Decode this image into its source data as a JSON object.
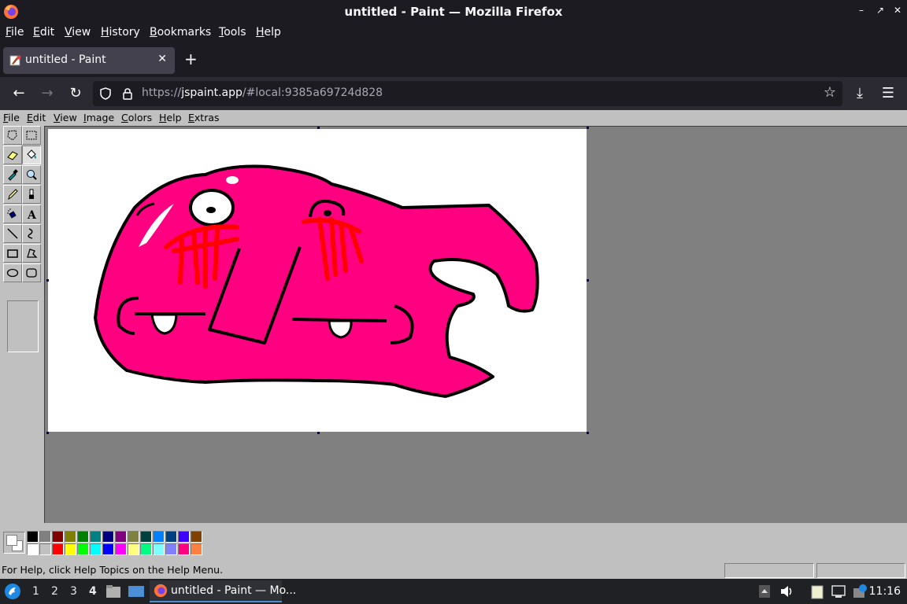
{
  "window": {
    "title": "untitled - Paint — Mozilla Firefox",
    "controls": [
      "–",
      "↗",
      "✕"
    ]
  },
  "firefox_menu": [
    "File",
    "Edit",
    "View",
    "History",
    "Bookmarks",
    "Tools",
    "Help"
  ],
  "tab": {
    "label": "untitled - Paint",
    "close": "✕",
    "new_tab": "+"
  },
  "nav": {
    "back": "←",
    "forward": "→",
    "reload": "↻",
    "url_prefix": "https://",
    "url_host": "jspaint.app",
    "url_rest": "/#local:9385a69724d828",
    "bookmark": "☆",
    "download": "⤓",
    "menu": "☰"
  },
  "paint_menu": [
    "File",
    "Edit",
    "View",
    "Image",
    "Colors",
    "Help",
    "Extras"
  ],
  "tools": [
    {
      "name": "free-form-select-tool"
    },
    {
      "name": "rectangle-select-tool"
    },
    {
      "name": "eraser-tool"
    },
    {
      "name": "fill-tool"
    },
    {
      "name": "pick-color-tool"
    },
    {
      "name": "magnifier-tool"
    },
    {
      "name": "pencil-tool"
    },
    {
      "name": "brush-tool"
    },
    {
      "name": "airbrush-tool"
    },
    {
      "name": "text-tool"
    },
    {
      "name": "line-tool"
    },
    {
      "name": "curve-tool"
    },
    {
      "name": "rectangle-tool"
    },
    {
      "name": "polygon-tool"
    },
    {
      "name": "ellipse-tool"
    },
    {
      "name": "rounded-rectangle-tool"
    }
  ],
  "palette": {
    "top": [
      "#000000",
      "#808080",
      "#800000",
      "#808000",
      "#008000",
      "#008080",
      "#000080",
      "#800080",
      "#808040",
      "#004040",
      "#0080ff",
      "#004080",
      "#4000ff",
      "#804000"
    ],
    "bottom": [
      "#ffffff",
      "#c0c0c0",
      "#ff0000",
      "#ffff00",
      "#00ff00",
      "#00ffff",
      "#0000ff",
      "#ff00ff",
      "#ffff80",
      "#00ff80",
      "#80ffff",
      "#8080ff",
      "#ff0080",
      "#ff8040"
    ]
  },
  "status": {
    "help_text": "For Help, click Help Topics on the Help Menu."
  },
  "taskbar": {
    "workspaces": [
      "1",
      "2",
      "3",
      "4"
    ],
    "active_workspace": "4",
    "task_label": "untitled - Paint — Mo...",
    "clock": "11:16"
  },
  "colors": {
    "pink": "#ff0080",
    "red": "#ff0000",
    "black": "#000000"
  }
}
